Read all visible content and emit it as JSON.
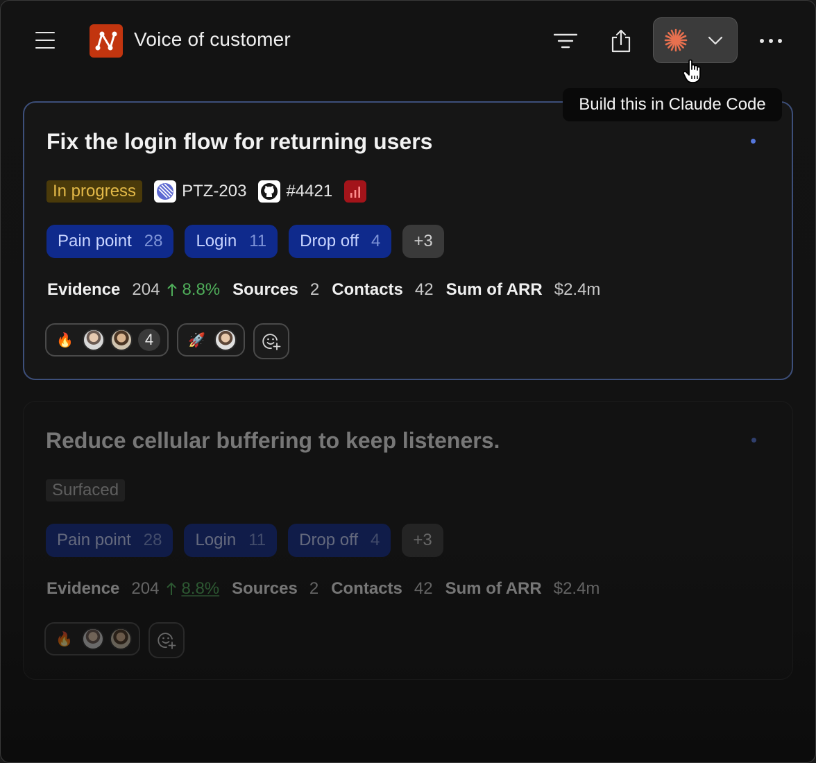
{
  "header": {
    "title": "Voice of customer",
    "tooltip": "Build this in Claude Code"
  },
  "colors": {
    "accent_claude": "#e8704f",
    "logo_bg": "#c2350f",
    "tag_bg": "#0f2a8c",
    "status_in_progress": "#e3b948",
    "trend_up": "#4fae5a"
  },
  "cards": [
    {
      "title": "Fix the login flow for returning users",
      "status": "In progress",
      "linear_id": "PTZ-203",
      "github_id": "#4421",
      "tags": [
        {
          "label": "Pain point",
          "count": "28"
        },
        {
          "label": "Login",
          "count": "11"
        },
        {
          "label": "Drop off",
          "count": "4"
        }
      ],
      "more_tags": "+3",
      "metrics": {
        "evidence_label": "Evidence",
        "evidence_value": "204",
        "evidence_trend": "8.8%",
        "sources_label": "Sources",
        "sources_value": "2",
        "contacts_label": "Contacts",
        "contacts_value": "42",
        "arr_label": "Sum of ARR",
        "arr_value": "$2.4m"
      },
      "reactions": [
        {
          "emoji": "🔥",
          "extra_count": "4"
        },
        {
          "emoji": "🚀"
        }
      ]
    },
    {
      "title": "Reduce cellular buffering to keep listeners.",
      "status": "Surfaced",
      "tags": [
        {
          "label": "Pain point",
          "count": "28"
        },
        {
          "label": "Login",
          "count": "11"
        },
        {
          "label": "Drop off",
          "count": "4"
        }
      ],
      "more_tags": "+3",
      "metrics": {
        "evidence_label": "Evidence",
        "evidence_value": "204",
        "evidence_trend": "8.8%",
        "sources_label": "Sources",
        "sources_value": "2",
        "contacts_label": "Contacts",
        "contacts_value": "42",
        "arr_label": "Sum of ARR",
        "arr_value": "$2.4m"
      },
      "reactions": [
        {
          "emoji": "🔥"
        }
      ]
    }
  ]
}
